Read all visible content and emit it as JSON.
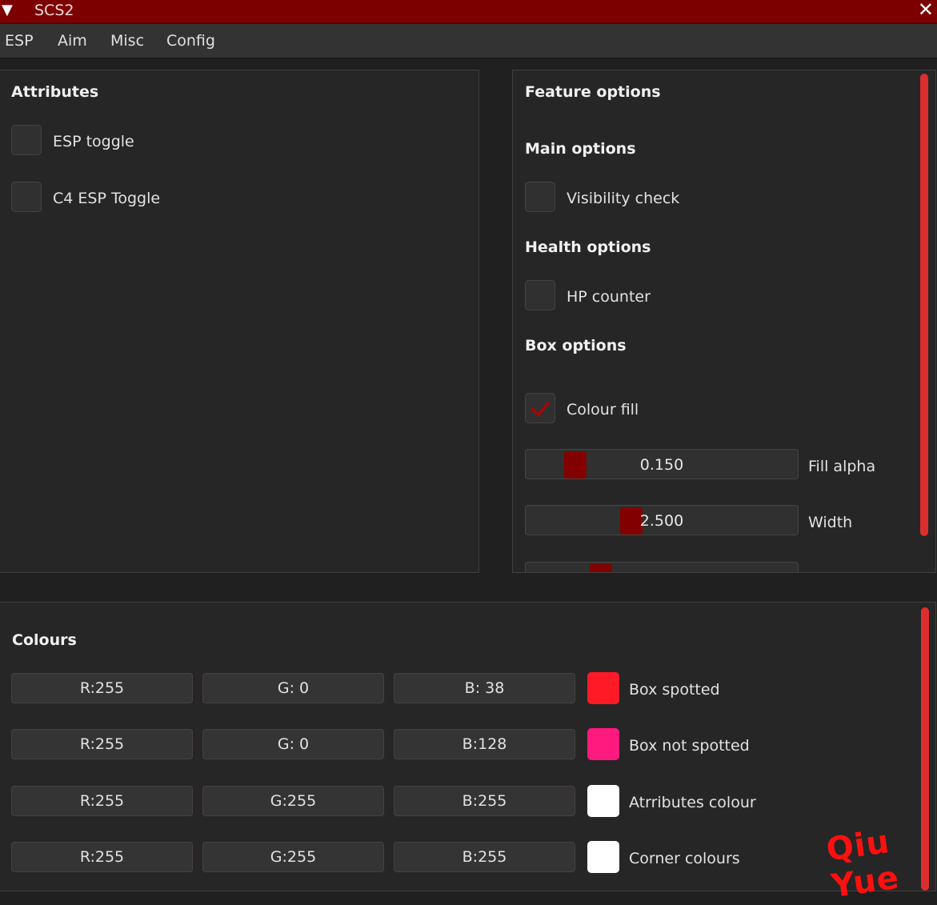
{
  "window": {
    "title": "SCS2",
    "collapse_glyph": "▼",
    "close_glyph": "✕"
  },
  "menu": [
    "ESP",
    "Aim",
    "Misc",
    "Config"
  ],
  "attributes": {
    "heading": "Attributes",
    "items": [
      {
        "label": "ESP toggle",
        "checked": false
      },
      {
        "label": "C4 ESP Toggle",
        "checked": false
      }
    ]
  },
  "features": {
    "heading": "Feature options",
    "main_heading": "Main options",
    "visibility_check": "Visibility check",
    "health_heading": "Health options",
    "hp_counter": "HP counter",
    "box_heading": "Box options",
    "colour_fill": "Colour fill",
    "colour_fill_checked": true,
    "sliders": [
      {
        "value": "0.150",
        "label": "Fill alpha",
        "fraction": 0.15
      },
      {
        "value": "2.500",
        "label": "Width",
        "fraction": 0.4
      },
      {
        "value": "",
        "label": "",
        "fraction": 0.3
      }
    ]
  },
  "colours": {
    "heading": "Colours",
    "rows": [
      {
        "r": "R:255",
        "g": "G:  0",
        "b": "B: 38",
        "swatch": "#ff1a26",
        "label": "Box spotted"
      },
      {
        "r": "R:255",
        "g": "G:  0",
        "b": "B:128",
        "swatch": "#ff1a80",
        "label": "Box not spotted"
      },
      {
        "r": "R:255",
        "g": "G:255",
        "b": "B:255",
        "swatch": "#ffffff",
        "label": "Atrributes colour"
      },
      {
        "r": "R:255",
        "g": "G:255",
        "b": "B:255",
        "swatch": "#ffffff",
        "label": "Corner colours"
      }
    ]
  },
  "watermark": "Qiu Yue",
  "colors": {
    "accent": "#7d0000",
    "scrollbar": "#dd2e2e",
    "background": "#202020"
  }
}
